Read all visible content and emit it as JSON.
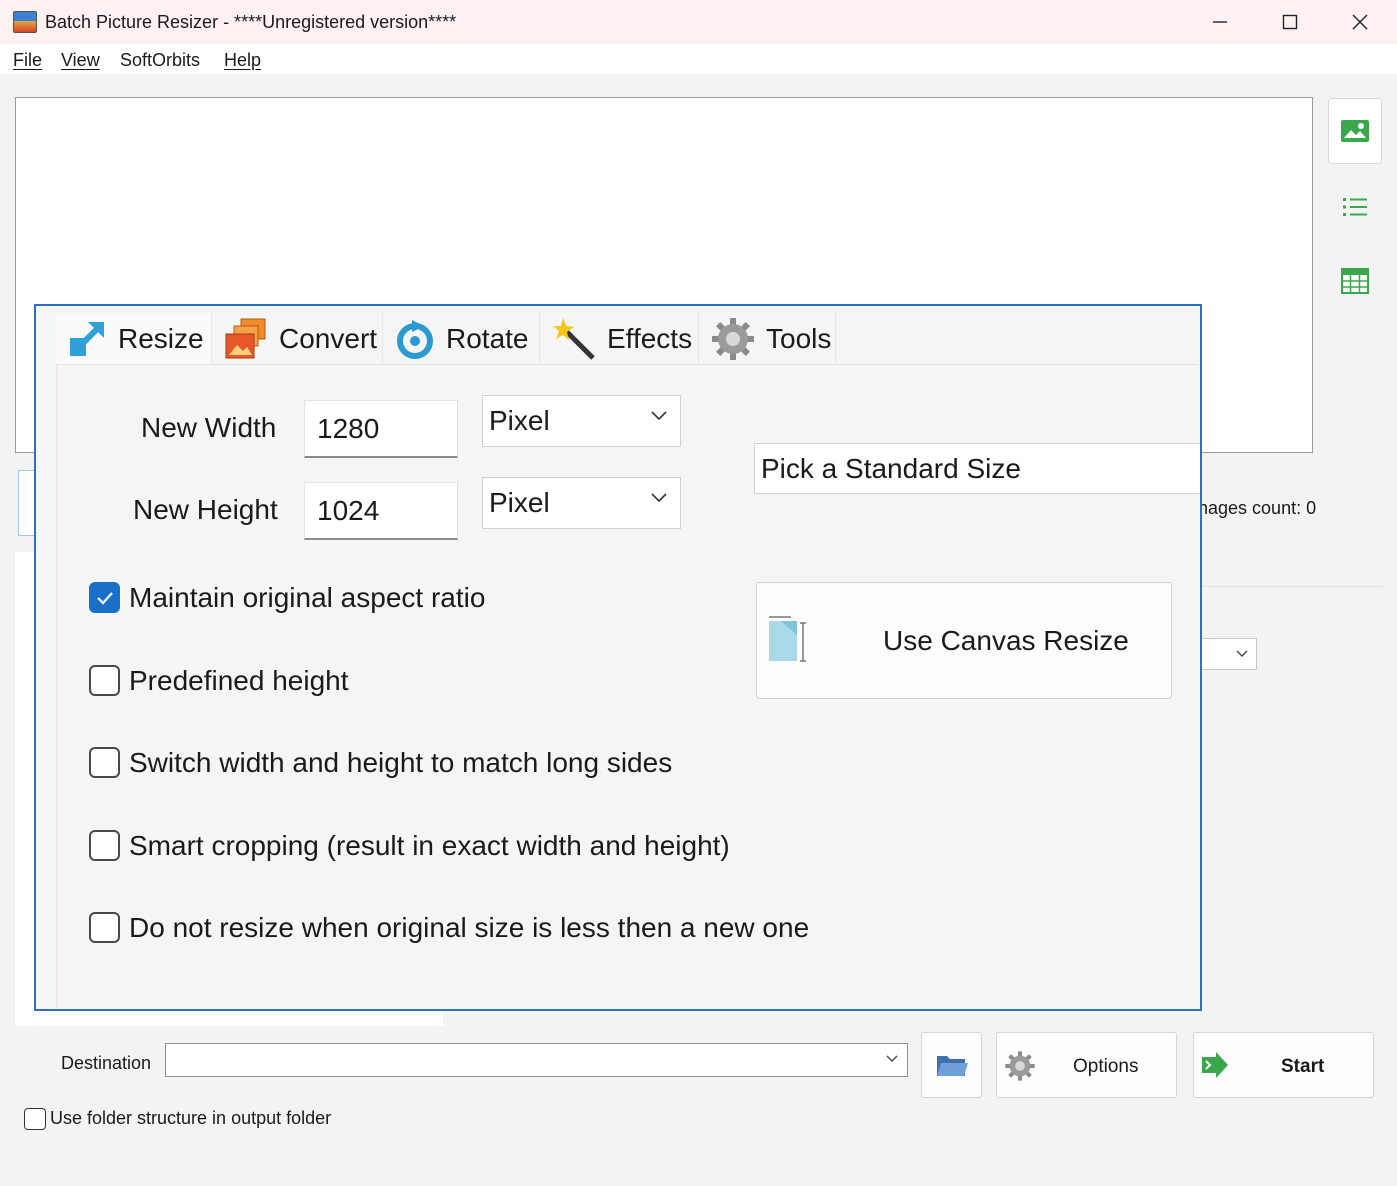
{
  "window": {
    "title": "Batch Picture Resizer - ****Unregistered version****",
    "controls": {
      "minimize": "—",
      "maximize": "☐",
      "close": "✕"
    }
  },
  "menu": [
    "File",
    "View",
    "SoftOrbits",
    "Help"
  ],
  "side_buttons": [
    "thumbnail-view-icon",
    "list-view-icon",
    "table-view-icon"
  ],
  "images_count_text": "nages count: 0",
  "tabs": [
    {
      "label": "Resize",
      "icon": "resize-arrow-icon",
      "active": true
    },
    {
      "label": "Convert",
      "icon": "convert-images-icon",
      "active": false
    },
    {
      "label": "Rotate",
      "icon": "rotate-icon",
      "active": false
    },
    {
      "label": "Effects",
      "icon": "magic-wand-icon",
      "active": false
    },
    {
      "label": "Tools",
      "icon": "gear-icon",
      "active": false
    }
  ],
  "resize": {
    "width_label": "New Width",
    "height_label": "New Height",
    "width_value": "1280",
    "height_value": "1024",
    "width_unit": "Pixel",
    "height_unit": "Pixel",
    "standard_size_placeholder": "Pick a Standard Size",
    "canvas_resize_label": "Use Canvas Resize",
    "options": [
      {
        "label": "Maintain original aspect ratio",
        "checked": true
      },
      {
        "label": "Predefined height",
        "checked": false
      },
      {
        "label": "Switch width and height to match long sides",
        "checked": false
      },
      {
        "label": "Smart cropping (result in exact width and height)",
        "checked": false
      },
      {
        "label": "Do not resize when original size is less then a new one",
        "checked": false
      }
    ]
  },
  "bottom": {
    "destination_label": "Destination",
    "destination_value": "",
    "options_label": "Options",
    "start_label": "Start",
    "folder_structure_label": "Use folder structure in output folder",
    "folder_structure_checked": false
  },
  "colors": {
    "accent": "#1a6fc9",
    "panel_border": "#2a6fc9",
    "icon_green": "#3aa84a"
  }
}
